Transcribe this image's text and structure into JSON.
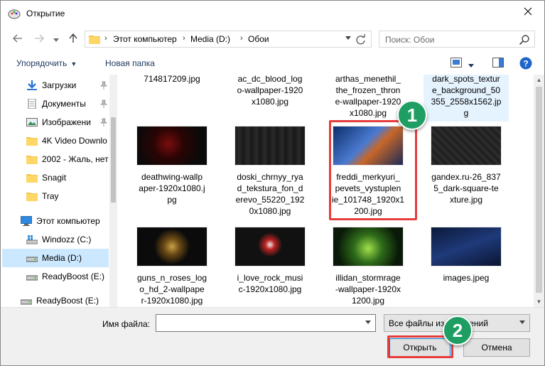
{
  "window": {
    "title": "Открытие"
  },
  "address": {
    "parts": [
      "Этот компьютер",
      "Media (D:)",
      "Обои"
    ]
  },
  "search": {
    "placeholder": "Поиск: Обои"
  },
  "toolbar": {
    "organize_label": "Упорядочить",
    "new_folder_label": "Новая папка"
  },
  "nav": {
    "items": [
      {
        "label": "Загрузки",
        "icon": "download-icon",
        "pinned": true
      },
      {
        "label": "Документы",
        "icon": "document-icon",
        "pinned": true
      },
      {
        "label": "Изображени",
        "icon": "pictures-icon",
        "pinned": true
      },
      {
        "label": "4K Video Downlo",
        "icon": "folder-icon"
      },
      {
        "label": "2002 - Жаль, нет",
        "icon": "folder-icon"
      },
      {
        "label": "Snagit",
        "icon": "folder-icon"
      },
      {
        "label": "Tray",
        "icon": "folder-icon"
      },
      {
        "label": "Этот компьютер",
        "icon": "computer-icon"
      },
      {
        "label": "Windozz (C:)",
        "icon": "windows-drive-icon"
      },
      {
        "label": "Media (D:)",
        "icon": "drive-icon",
        "selected": true
      },
      {
        "label": "ReadyBoost (E:)",
        "icon": "drive-icon"
      },
      {
        "label": "ReadyBoost (E:)",
        "icon": "drive-icon"
      }
    ]
  },
  "files": {
    "row0": [
      {
        "name": "714817209.jpg"
      },
      {
        "name": "ac_dc_blood_log\no-wallpaper-1920\nx1080.jpg"
      },
      {
        "name": "arthas_menethil_\nthe_frozen_thron\ne-wallpaper-1920\nx1080.jpg"
      },
      {
        "name": "dark_spots_textur\ne_background_50\n355_2558x1562.jp\ng"
      }
    ],
    "row1": [
      {
        "name": "deathwing-wallp\naper-1920x1080.j\npg"
      },
      {
        "name": "doski_chrnyy_rya\nd_tekstura_fon_d\nerevo_55220_192\n0x1080.jpg"
      },
      {
        "name": "freddi_merkyuri_\npevets_vystuplen\nie_101748_1920x1\n200.jpg"
      },
      {
        "name": "gandex.ru-26_837\n5_dark-square-te\nxture.jpg"
      }
    ],
    "row2": [
      {
        "name": "guns_n_roses_log\no_hd_2-wallpape\nr-1920x1080.jpg"
      },
      {
        "name": "i_love_rock_musi\nc-1920x1080.jpg"
      },
      {
        "name": "illidan_stormrage\n-wallpaper-1920x\n1200.jpg"
      },
      {
        "name": "images.jpeg"
      }
    ]
  },
  "bottom": {
    "filename_label": "Имя файла:",
    "filename_value": "",
    "filetype_value": "Все файлы изображений",
    "open_label": "Открыть",
    "cancel_label": "Отмена"
  },
  "annotations": {
    "badge1": "1",
    "badge2": "2",
    "highlight_color": "#e63c3c",
    "badge_color": "#1f9e64"
  }
}
